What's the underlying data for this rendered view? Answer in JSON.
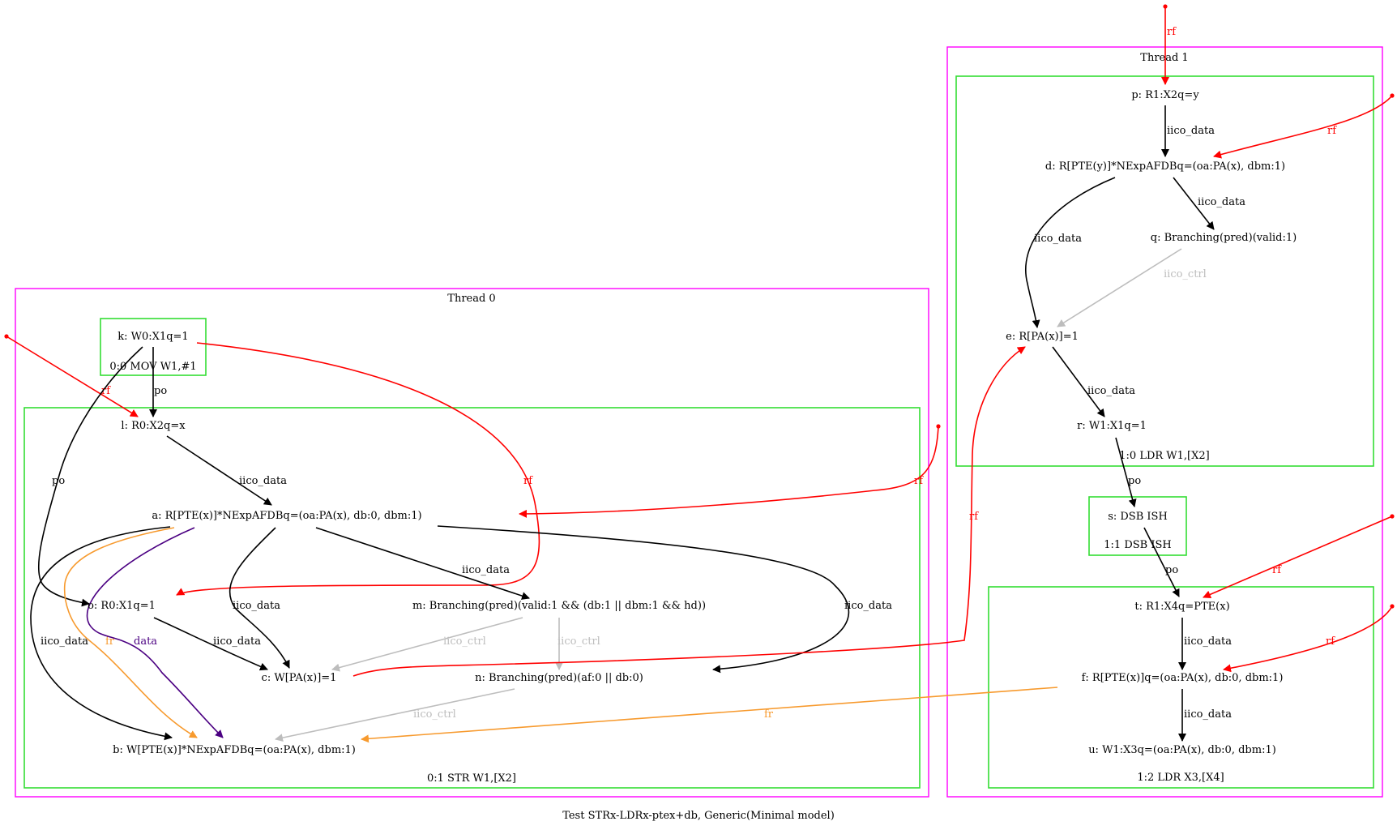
{
  "caption": "Test STRx-LDRx-ptex+db, Generic(Minimal model)",
  "colors": {
    "black": "#000000",
    "rf": "#ff0000",
    "fr": "#f79a2e",
    "data": "#4b0082",
    "ctrl": "#bdbdbd",
    "thread_box": "#ff00ff",
    "instr_box": "#33dd33"
  },
  "threads": [
    {
      "label": "Thread 0",
      "instructions": [
        "0:0 MOV W1,#1",
        "0:1 STR W1,[X2]"
      ]
    },
    {
      "label": "Thread 1",
      "instructions": [
        "1:0 LDR W1,[X2]",
        "1:1 DSB ISH",
        "1:2 LDR X3,[X4]"
      ]
    }
  ],
  "nodes": {
    "k": "k: W0:X1q=1",
    "l": "l: R0:X2q=x",
    "a": "a: R[PTE(x)]*NExpAFDBq=(oa:PA(x), db:0, dbm:1)",
    "o": "o: R0:X1q=1",
    "m": "m: Branching(pred)(valid:1 && (db:1 || dbm:1 && hd))",
    "c": "c: W[PA(x)]=1",
    "n": "n: Branching(pred)(af:0 || db:0)",
    "b": "b: W[PTE(x)]*NExpAFDBq=(oa:PA(x), dbm:1)",
    "p": "p: R1:X2q=y",
    "d": "d: R[PTE(y)]*NExpAFDBq=(oa:PA(x), dbm:1)",
    "q": "q: Branching(pred)(valid:1)",
    "e": "e: R[PA(x)]=1",
    "r": "r: W1:X1q=1",
    "s": "s: DSB ISH",
    "t": "t: R1:X4q=PTE(x)",
    "f": "f: R[PTE(x)]q=(oa:PA(x), db:0, dbm:1)",
    "u": "u: W1:X3q=(oa:PA(x), db:0, dbm:1)"
  },
  "edge_labels": {
    "rf": "rf",
    "po": "po",
    "iico_data": "iico_data",
    "iico_ctrl": "iico_ctrl",
    "fr": "fr",
    "data": "data"
  },
  "edges": [
    {
      "from": "init",
      "to": "l",
      "kind": "rf"
    },
    {
      "from": "k",
      "to": "l",
      "kind": "po"
    },
    {
      "from": "k",
      "to": "o",
      "kind": "po"
    },
    {
      "from": "k",
      "to": "o",
      "kind": "rf"
    },
    {
      "from": "l",
      "to": "a",
      "kind": "iico_data"
    },
    {
      "from": "init",
      "to": "a",
      "kind": "rf"
    },
    {
      "from": "a",
      "to": "b",
      "kind": "iico_data"
    },
    {
      "from": "a",
      "to": "b",
      "kind": "fr"
    },
    {
      "from": "a",
      "to": "b",
      "kind": "data"
    },
    {
      "from": "a",
      "to": "c",
      "kind": "iico_data"
    },
    {
      "from": "a",
      "to": "m",
      "kind": "iico_data"
    },
    {
      "from": "a",
      "to": "n",
      "kind": "iico_data"
    },
    {
      "from": "o",
      "to": "c",
      "kind": "iico_data"
    },
    {
      "from": "m",
      "to": "c",
      "kind": "iico_ctrl"
    },
    {
      "from": "m",
      "to": "n",
      "kind": "iico_ctrl"
    },
    {
      "from": "n",
      "to": "b",
      "kind": "iico_ctrl"
    },
    {
      "from": "c",
      "to": "e",
      "kind": "rf"
    },
    {
      "from": "init",
      "to": "p",
      "kind": "rf"
    },
    {
      "from": "p",
      "to": "d",
      "kind": "iico_data"
    },
    {
      "from": "init",
      "to": "d",
      "kind": "rf"
    },
    {
      "from": "d",
      "to": "q",
      "kind": "iico_data"
    },
    {
      "from": "d",
      "to": "e",
      "kind": "iico_data"
    },
    {
      "from": "q",
      "to": "e",
      "kind": "iico_ctrl"
    },
    {
      "from": "e",
      "to": "r",
      "kind": "iico_data"
    },
    {
      "from": "r",
      "to": "s",
      "kind": "po"
    },
    {
      "from": "s",
      "to": "t",
      "kind": "po"
    },
    {
      "from": "init",
      "to": "t",
      "kind": "rf"
    },
    {
      "from": "t",
      "to": "f",
      "kind": "iico_data"
    },
    {
      "from": "init",
      "to": "f",
      "kind": "rf"
    },
    {
      "from": "f",
      "to": "u",
      "kind": "iico_data"
    },
    {
      "from": "f",
      "to": "b",
      "kind": "fr"
    }
  ]
}
